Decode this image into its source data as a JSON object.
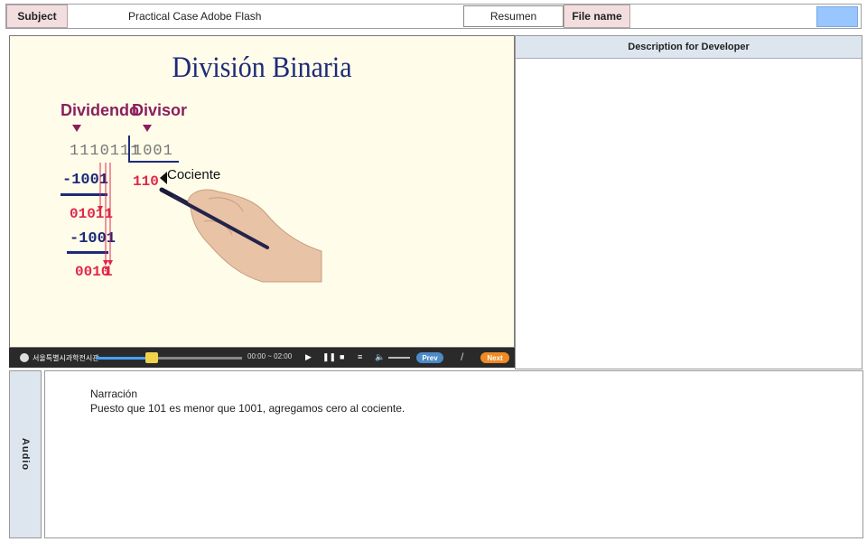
{
  "header": {
    "subject_label": "Subject",
    "subject_value": "Practical Case Adobe Flash",
    "resumen_label": "Resumen",
    "filename_label": "File name",
    "filename_value": ""
  },
  "slide": {
    "title": "División Binaria",
    "dividend_label": "Dividendo",
    "divisor_label": "Divisor",
    "dividend": "1110111",
    "divisor": "1001",
    "quotient": "110",
    "quotient_label": "Cociente",
    "steps": [
      {
        "type": "sub",
        "text": "-1001"
      },
      {
        "type": "rem",
        "text": "01011"
      },
      {
        "type": "sub",
        "text": "-1001"
      },
      {
        "type": "rem",
        "text": "0010"
      },
      {
        "type": "tail",
        "text": "1"
      }
    ]
  },
  "player": {
    "brand": "서울특별시과학전시관",
    "time": "00:00 ~ 02:00",
    "progress": 0.38,
    "prev_label": "Prev",
    "separator": "/",
    "next_label": "Next"
  },
  "developer": {
    "heading": "Description for Developer",
    "body": ""
  },
  "audio": {
    "side_label": "Audio",
    "narration_title": "Narración",
    "narration_text": "Puesto que 101 es menor que 1001, agregamos cero al cociente."
  },
  "colors": {
    "slide_bg": "#fffde9",
    "title_blue": "#1d2a7a",
    "label_magenta": "#8b1f5e",
    "number_red": "#e0264a",
    "next_orange": "#f08a24",
    "prev_blue": "#4d8bc7"
  }
}
